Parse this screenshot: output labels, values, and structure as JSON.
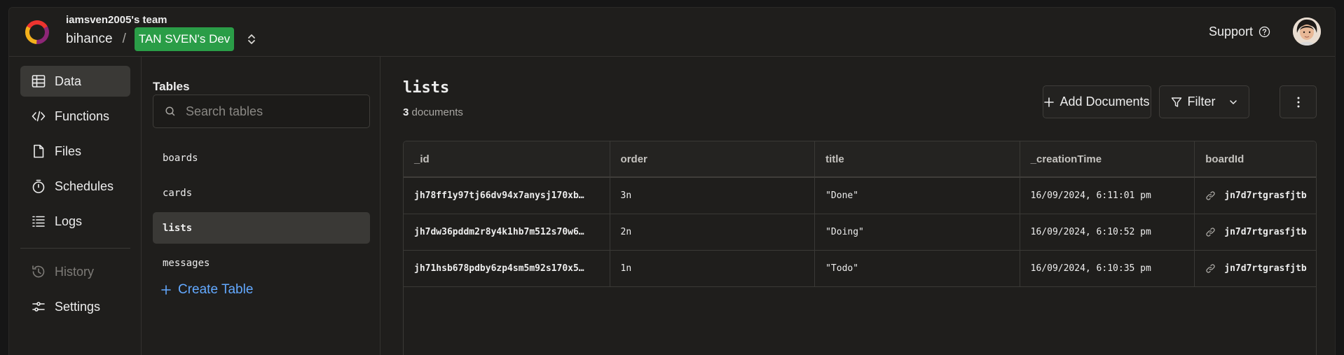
{
  "header": {
    "team_name": "iamsven2005's team",
    "project": "bihance",
    "separator": "/",
    "deployment": "TAN SVEN's Dev",
    "support_label": "Support"
  },
  "sidebar": {
    "items": [
      {
        "label": "Data",
        "icon": "table-icon",
        "active": true
      },
      {
        "label": "Functions",
        "icon": "code-icon"
      },
      {
        "label": "Files",
        "icon": "file-icon"
      },
      {
        "label": "Schedules",
        "icon": "stopwatch-icon"
      },
      {
        "label": "Logs",
        "icon": "logs-icon"
      },
      {
        "label": "History",
        "icon": "history-icon",
        "disabled": true
      },
      {
        "label": "Settings",
        "icon": "settings-sliders-icon"
      }
    ]
  },
  "tables_panel": {
    "title": "Tables",
    "search_placeholder": "Search tables",
    "tables": [
      "boards",
      "cards",
      "lists",
      "messages"
    ],
    "selected_table": "lists",
    "create_label": "Create Table"
  },
  "main": {
    "title": "lists",
    "doc_count": "3",
    "doc_count_suffix": " documents",
    "add_label": "Add Documents",
    "filter_label": "Filter",
    "columns": [
      "_id",
      "order",
      "title",
      "_creationTime",
      "boardId"
    ],
    "rows": [
      {
        "_id": "jh78ff1y97tj66dv94x7anysj170xb…",
        "order": "3n",
        "title": "\"Done\"",
        "_creationTime": "16/09/2024, 6:11:01 pm",
        "boardId": "jn7d7rtgrasfjtb"
      },
      {
        "_id": "jh7dw36pddm2r8y4k1hb7m512s70w6…",
        "order": "2n",
        "title": "\"Doing\"",
        "_creationTime": "16/09/2024, 6:10:52 pm",
        "boardId": "jn7d7rtgrasfjtb"
      },
      {
        "_id": "jh71hsb678pdby6zp4sm5m92s170x5…",
        "order": "1n",
        "title": "\"Todo\"",
        "_creationTime": "16/09/2024, 6:10:35 pm",
        "boardId": "jn7d7rtgrasfjtb"
      }
    ]
  },
  "colors": {
    "background": "#1f1e1c",
    "deployment_badge": "#2a9d47",
    "link_accent": "#63a9ff",
    "active_item": "#3a3936"
  }
}
